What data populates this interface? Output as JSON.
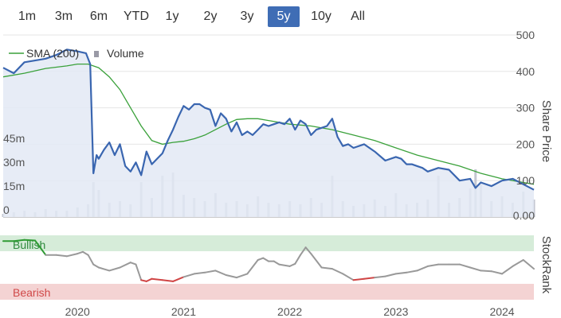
{
  "range_buttons": [
    {
      "label": "1m",
      "active": false
    },
    {
      "label": "3m",
      "active": false
    },
    {
      "label": "6m",
      "active": false
    },
    {
      "label": "YTD",
      "active": false
    },
    {
      "label": "1y",
      "active": false
    },
    {
      "label": "2y",
      "active": false
    },
    {
      "label": "3y",
      "active": false
    },
    {
      "label": "5y",
      "active": true
    },
    {
      "label": "10y",
      "active": false
    },
    {
      "label": "All",
      "active": false
    }
  ],
  "colors": {
    "price": "#3a66b0",
    "price_fill": "#e3e9f4",
    "sma": "#3aa13a",
    "volume": "#c4c7d2",
    "bullish_band": "#d6ecd9",
    "bearish_band": "#f4d3d3",
    "bullish_text": "#2f8a3e",
    "bearish_text": "#d04848",
    "rank_line": "#999999",
    "rank_bull": "#2e9a33",
    "rank_bear": "#d04545",
    "grid": "#e6e6e6"
  },
  "chart_data": {
    "type": "line",
    "x_labels": [
      "2020",
      "2021",
      "2022",
      "2023",
      "2024"
    ],
    "legend": {
      "sma": "SMA (200)",
      "volume": "Volume"
    },
    "price_axis": {
      "label": "Share Price",
      "ticks": [
        "500",
        "400",
        "300",
        "200",
        "100",
        "0.00"
      ],
      "range": [
        0,
        500
      ]
    },
    "volume_axis": {
      "ticks": [
        "45m",
        "30m",
        "15m",
        "0"
      ],
      "range": [
        0,
        60
      ]
    },
    "rank_axis": {
      "label": "StockRank",
      "range": [
        0,
        100
      ]
    },
    "rank_bands": {
      "bullish": "Bullish",
      "bearish": "Bearish"
    },
    "series": [
      {
        "name": "Share Price",
        "x": [
          2019.3,
          2019.4,
          2019.5,
          2019.6,
          2019.7,
          2019.8,
          2019.9,
          2020.0,
          2020.08,
          2020.12,
          2020.15,
          2020.18,
          2020.2,
          2020.25,
          2020.3,
          2020.35,
          2020.4,
          2020.45,
          2020.5,
          2020.55,
          2020.6,
          2020.65,
          2020.7,
          2020.75,
          2020.8,
          2020.85,
          2020.9,
          2020.95,
          2021.0,
          2021.05,
          2021.1,
          2021.15,
          2021.2,
          2021.25,
          2021.3,
          2021.35,
          2021.4,
          2021.45,
          2021.5,
          2021.55,
          2021.6,
          2021.65,
          2021.7,
          2021.75,
          2021.8,
          2021.85,
          2021.9,
          2021.95,
          2022.0,
          2022.05,
          2022.1,
          2022.15,
          2022.2,
          2022.25,
          2022.3,
          2022.35,
          2022.4,
          2022.45,
          2022.5,
          2022.55,
          2022.6,
          2022.7,
          2022.8,
          2022.9,
          2023.0,
          2023.05,
          2023.1,
          2023.15,
          2023.2,
          2023.25,
          2023.3,
          2023.4,
          2023.5,
          2023.6,
          2023.7,
          2023.75,
          2023.8,
          2023.9,
          2024.0,
          2024.1,
          2024.2,
          2024.3
        ],
        "y": [
          410,
          395,
          425,
          430,
          435,
          445,
          460,
          455,
          450,
          420,
          120,
          170,
          160,
          185,
          205,
          170,
          200,
          140,
          125,
          150,
          115,
          180,
          145,
          160,
          175,
          210,
          240,
          275,
          305,
          295,
          310,
          310,
          300,
          295,
          250,
          285,
          270,
          235,
          260,
          225,
          235,
          225,
          240,
          255,
          250,
          255,
          260,
          255,
          270,
          240,
          265,
          255,
          225,
          240,
          245,
          250,
          270,
          220,
          195,
          200,
          190,
          200,
          180,
          155,
          165,
          160,
          145,
          145,
          140,
          135,
          125,
          135,
          130,
          100,
          105,
          80,
          95,
          85,
          100,
          105,
          90,
          75
        ]
      },
      {
        "name": "SMA (200)",
        "x": [
          2019.3,
          2019.5,
          2019.7,
          2019.9,
          2020.0,
          2020.1,
          2020.2,
          2020.3,
          2020.4,
          2020.5,
          2020.6,
          2020.7,
          2020.8,
          2020.9,
          2021.0,
          2021.1,
          2021.2,
          2021.3,
          2021.4,
          2021.5,
          2021.6,
          2021.7,
          2021.8,
          2021.9,
          2022.0,
          2022.2,
          2022.4,
          2022.6,
          2022.8,
          2023.0,
          2023.2,
          2023.4,
          2023.6,
          2023.8,
          2024.0,
          2024.3
        ],
        "y": [
          385,
          395,
          408,
          415,
          420,
          420,
          410,
          385,
          350,
          300,
          250,
          210,
          200,
          205,
          208,
          215,
          225,
          240,
          255,
          268,
          270,
          270,
          265,
          260,
          255,
          250,
          240,
          225,
          210,
          190,
          170,
          155,
          140,
          120,
          105,
          90
        ]
      },
      {
        "name": "Volume",
        "x": [
          2019.3,
          2019.4,
          2019.5,
          2019.6,
          2019.7,
          2019.8,
          2019.9,
          2020.0,
          2020.1,
          2020.15,
          2020.2,
          2020.3,
          2020.4,
          2020.5,
          2020.6,
          2020.7,
          2020.8,
          2020.9,
          2021.0,
          2021.1,
          2021.2,
          2021.3,
          2021.4,
          2021.5,
          2021.6,
          2021.7,
          2021.8,
          2021.9,
          2022.0,
          2022.1,
          2022.2,
          2022.3,
          2022.4,
          2022.5,
          2022.6,
          2022.7,
          2022.8,
          2022.9,
          2023.0,
          2023.1,
          2023.2,
          2023.3,
          2023.4,
          2023.5,
          2023.6,
          2023.7,
          2023.75,
          2023.8,
          2023.9,
          2024.0,
          2024.1,
          2024.2,
          2024.3
        ],
        "y": [
          2,
          3,
          4,
          3,
          5,
          4,
          4,
          6,
          8,
          22,
          17,
          9,
          10,
          8,
          22,
          12,
          26,
          28,
          14,
          12,
          10,
          15,
          9,
          10,
          8,
          13,
          9,
          8,
          10,
          8,
          12,
          9,
          26,
          10,
          7,
          8,
          11,
          7,
          15,
          8,
          9,
          11,
          26,
          9,
          12,
          18,
          30,
          22,
          10,
          13,
          9,
          16,
          11
        ]
      },
      {
        "name": "StockRank",
        "x": [
          2019.3,
          2019.4,
          2019.5,
          2019.6,
          2019.7,
          2019.8,
          2019.9,
          2020.0,
          2020.05,
          2020.1,
          2020.15,
          2020.2,
          2020.3,
          2020.4,
          2020.5,
          2020.55,
          2020.6,
          2020.65,
          2020.7,
          2020.8,
          2020.9,
          2021.0,
          2021.1,
          2021.2,
          2021.3,
          2021.4,
          2021.5,
          2021.6,
          2021.7,
          2021.75,
          2021.8,
          2021.85,
          2021.9,
          2022.0,
          2022.05,
          2022.1,
          2022.15,
          2022.2,
          2022.3,
          2022.4,
          2022.5,
          2022.6,
          2022.7,
          2022.8,
          2022.9,
          2023.0,
          2023.1,
          2023.2,
          2023.3,
          2023.4,
          2023.5,
          2023.6,
          2023.7,
          2023.8,
          2023.9,
          2024.0,
          2024.1,
          2024.2,
          2024.3
        ],
        "y": [
          92,
          92,
          94,
          93,
          70,
          70,
          68,
          72,
          75,
          70,
          55,
          50,
          45,
          50,
          58,
          55,
          30,
          28,
          32,
          30,
          28,
          35,
          40,
          42,
          45,
          38,
          34,
          40,
          62,
          65,
          60,
          60,
          55,
          52,
          56,
          70,
          82,
          72,
          50,
          48,
          40,
          30,
          32,
          34,
          36,
          40,
          42,
          45,
          52,
          55,
          55,
          55,
          50,
          45,
          44,
          40,
          52,
          62,
          48
        ]
      }
    ]
  }
}
